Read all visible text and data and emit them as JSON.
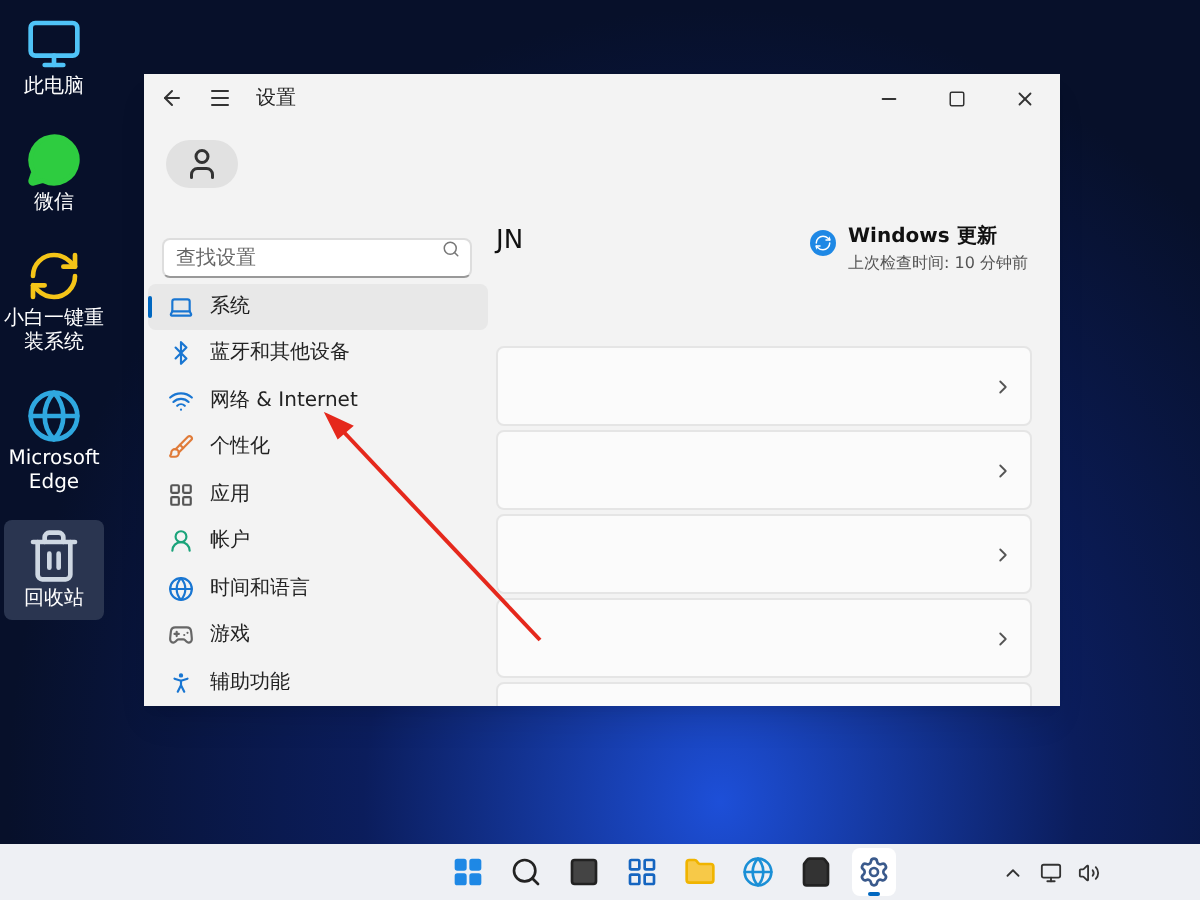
{
  "desktop_icons": [
    {
      "kind": "pc",
      "label": "此电脑",
      "selected": false
    },
    {
      "kind": "wechat",
      "label": "微信",
      "selected": false
    },
    {
      "kind": "installer",
      "label": "小白一键重装系统",
      "selected": false
    },
    {
      "kind": "edge",
      "label": "Microsoft Edge",
      "selected": false
    },
    {
      "kind": "recycle",
      "label": "回收站",
      "selected": true
    }
  ],
  "window": {
    "title": "设置",
    "search": {
      "placeholder": "查找设置"
    },
    "nav_items": [
      {
        "kind": "system",
        "label": "系统",
        "selected": true
      },
      {
        "kind": "bluetooth",
        "label": "蓝牙和其他设备",
        "selected": false
      },
      {
        "kind": "network",
        "label": "网络 & Internet",
        "selected": false
      },
      {
        "kind": "personalize",
        "label": "个性化",
        "selected": false
      },
      {
        "kind": "apps",
        "label": "应用",
        "selected": false
      },
      {
        "kind": "accounts",
        "label": "帐户",
        "selected": false
      },
      {
        "kind": "time",
        "label": "时间和语言",
        "selected": false
      },
      {
        "kind": "gaming",
        "label": "游戏",
        "selected": false
      },
      {
        "kind": "accessibility",
        "label": "辅助功能",
        "selected": false
      }
    ],
    "user_name": "JN",
    "update": {
      "title": "Windows 更新",
      "subtitle": "上次检查时间: 10 分钟前"
    }
  },
  "taskbar": {
    "apps": [
      {
        "kind": "start",
        "selected": false
      },
      {
        "kind": "search",
        "selected": false
      },
      {
        "kind": "taskview",
        "selected": false
      },
      {
        "kind": "widgets",
        "selected": false
      },
      {
        "kind": "explorer",
        "selected": false
      },
      {
        "kind": "edge",
        "selected": false
      },
      {
        "kind": "store",
        "selected": false
      },
      {
        "kind": "settings",
        "selected": true
      }
    ]
  }
}
